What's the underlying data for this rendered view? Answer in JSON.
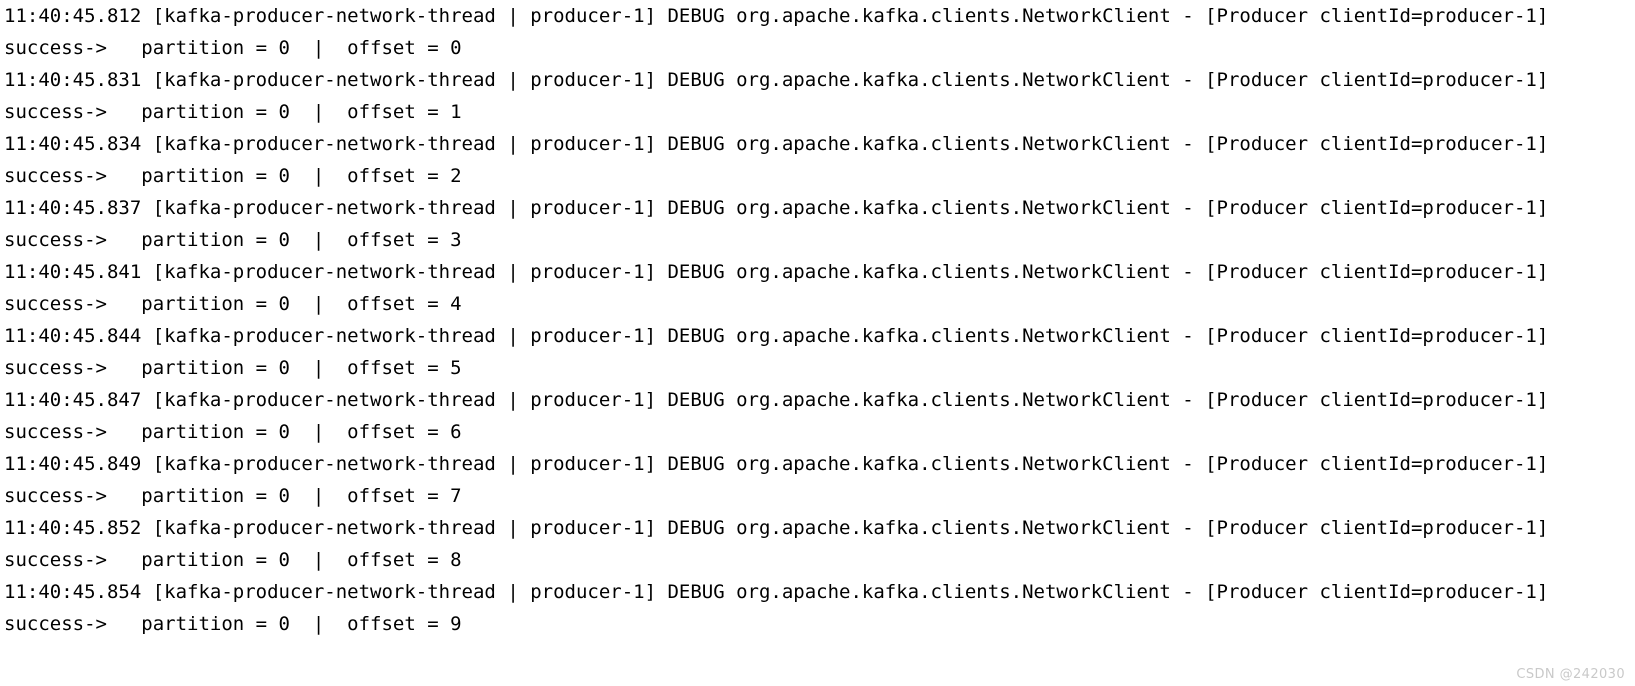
{
  "console": {
    "background_color": "#ffffff",
    "text_color": "#000000",
    "font_size_px": 19,
    "line_height_px": 32
  },
  "watermark": {
    "text": "CSDN @242030",
    "color": "#c9c9c9"
  },
  "log": {
    "thread": "kafka-producer-network-thread | producer-1",
    "level": "DEBUG",
    "logger": "org.apache.kafka.clients.NetworkClient",
    "client_id": "producer-1",
    "lines": [
      {
        "type": "debug",
        "text": "11:40:45.812 [kafka-producer-network-thread | producer-1] DEBUG org.apache.kafka.clients.NetworkClient - [Producer clientId=producer-1]"
      },
      {
        "type": "result",
        "text": "success->   partition = 0  |  offset = 0"
      },
      {
        "type": "debug",
        "text": "11:40:45.831 [kafka-producer-network-thread | producer-1] DEBUG org.apache.kafka.clients.NetworkClient - [Producer clientId=producer-1]"
      },
      {
        "type": "result",
        "text": "success->   partition = 0  |  offset = 1"
      },
      {
        "type": "debug",
        "text": "11:40:45.834 [kafka-producer-network-thread | producer-1] DEBUG org.apache.kafka.clients.NetworkClient - [Producer clientId=producer-1]"
      },
      {
        "type": "result",
        "text": "success->   partition = 0  |  offset = 2"
      },
      {
        "type": "debug",
        "text": "11:40:45.837 [kafka-producer-network-thread | producer-1] DEBUG org.apache.kafka.clients.NetworkClient - [Producer clientId=producer-1]"
      },
      {
        "type": "result",
        "text": "success->   partition = 0  |  offset = 3"
      },
      {
        "type": "debug",
        "text": "11:40:45.841 [kafka-producer-network-thread | producer-1] DEBUG org.apache.kafka.clients.NetworkClient - [Producer clientId=producer-1]"
      },
      {
        "type": "result",
        "text": "success->   partition = 0  |  offset = 4"
      },
      {
        "type": "debug",
        "text": "11:40:45.844 [kafka-producer-network-thread | producer-1] DEBUG org.apache.kafka.clients.NetworkClient - [Producer clientId=producer-1]"
      },
      {
        "type": "result",
        "text": "success->   partition = 0  |  offset = 5"
      },
      {
        "type": "debug",
        "text": "11:40:45.847 [kafka-producer-network-thread | producer-1] DEBUG org.apache.kafka.clients.NetworkClient - [Producer clientId=producer-1]"
      },
      {
        "type": "result",
        "text": "success->   partition = 0  |  offset = 6"
      },
      {
        "type": "debug",
        "text": "11:40:45.849 [kafka-producer-network-thread | producer-1] DEBUG org.apache.kafka.clients.NetworkClient - [Producer clientId=producer-1]"
      },
      {
        "type": "result",
        "text": "success->   partition = 0  |  offset = 7"
      },
      {
        "type": "debug",
        "text": "11:40:45.852 [kafka-producer-network-thread | producer-1] DEBUG org.apache.kafka.clients.NetworkClient - [Producer clientId=producer-1]"
      },
      {
        "type": "result",
        "text": "success->   partition = 0  |  offset = 8"
      },
      {
        "type": "debug",
        "text": "11:40:45.854 [kafka-producer-network-thread | producer-1] DEBUG org.apache.kafka.clients.NetworkClient - [Producer clientId=producer-1]"
      },
      {
        "type": "result",
        "text": "success->   partition = 0  |  offset = 9"
      }
    ]
  }
}
